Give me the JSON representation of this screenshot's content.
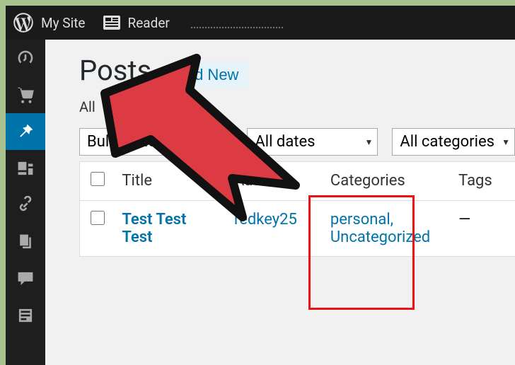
{
  "topbar": {
    "mysite": "My Site",
    "reader": "Reader"
  },
  "page": {
    "title": "Posts",
    "add_new": "Add New",
    "status_prefix": "All"
  },
  "filters": {
    "bulk": "Bulk Actions",
    "dates": "All dates",
    "cats": "All categories"
  },
  "table": {
    "headers": {
      "title": "Title",
      "author": "Author",
      "categories": "Categories",
      "tags": "Tags"
    },
    "rows": [
      {
        "title": "Test Test Test",
        "author": "redkey25",
        "categories": "personal, Uncategorized",
        "tags": "—"
      }
    ]
  }
}
